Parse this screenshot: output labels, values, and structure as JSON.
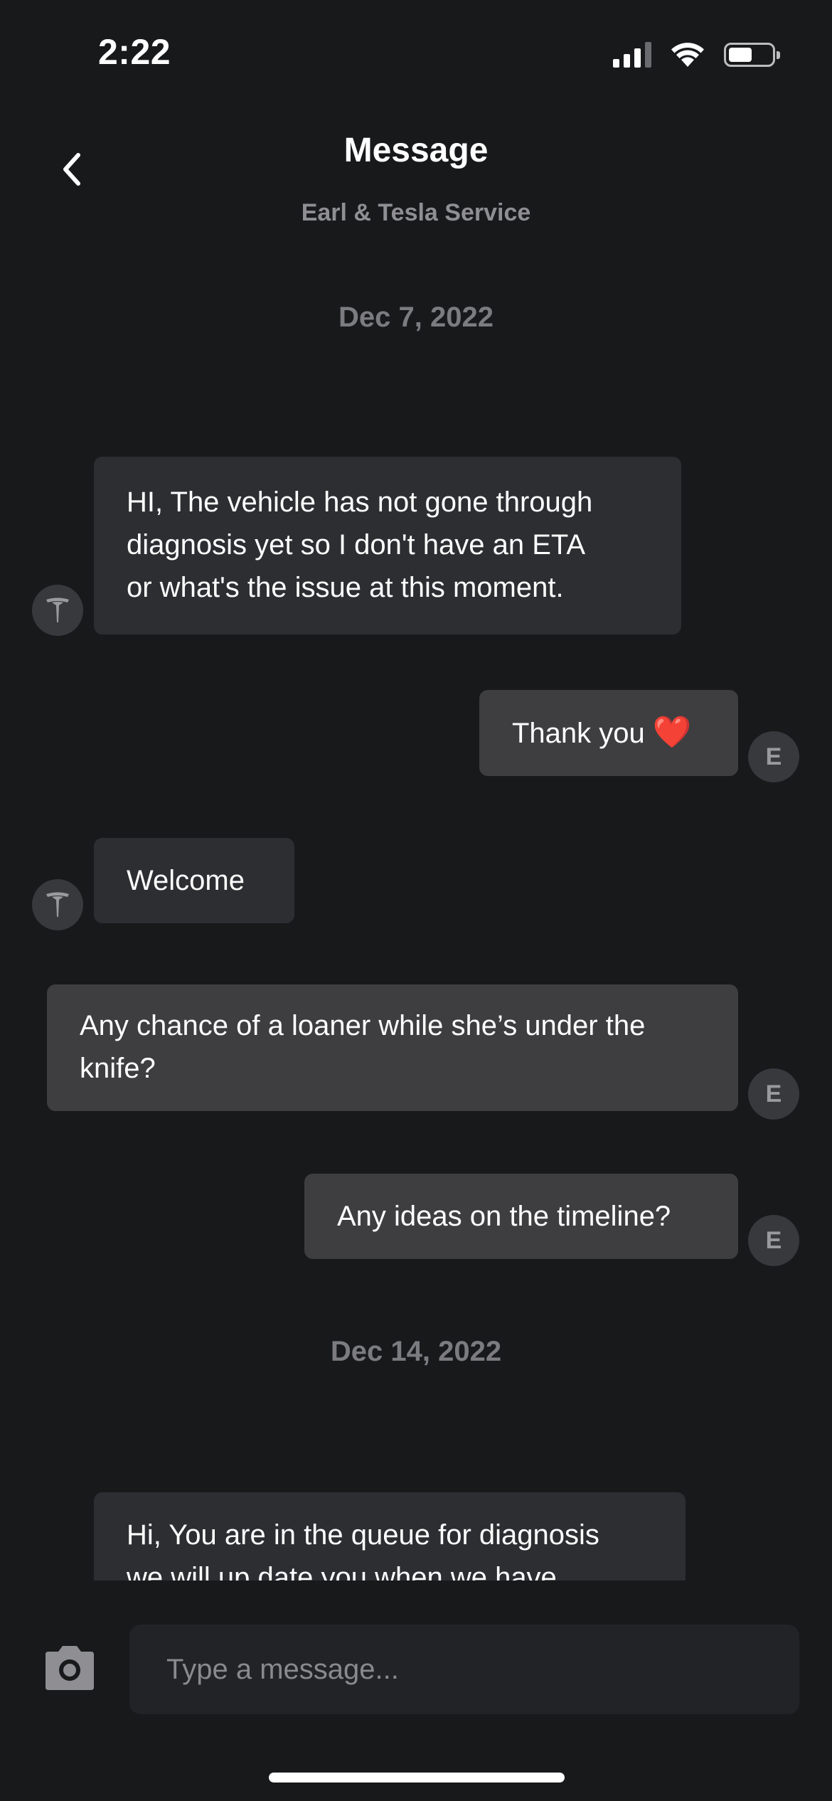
{
  "status_bar": {
    "time": "2:22",
    "battery_level": 0.55
  },
  "header": {
    "title": "Message",
    "subtitle": "Earl & Tesla Service"
  },
  "thread": {
    "date_1": "Dec 7, 2022",
    "msg_1_lines": [
      "HI, The vehicle has not gone through",
      "diagnosis yet so I don't have an ETA",
      "or what's the issue at this moment."
    ],
    "msg_2_text": "Thank you",
    "msg_2_emoji": "❤️",
    "msg_3_text": "Welcome",
    "msg_4_lines": [
      "Any chance of a loaner while she’s under the",
      "knife?"
    ],
    "msg_5_text": "Any ideas on the timeline?",
    "date_2": "Dec 14, 2022",
    "msg_6_lines": [
      "Hi, You are in the queue for diagnosis",
      "we will up date you when we have"
    ],
    "user_initial": "E"
  },
  "composer": {
    "placeholder": "Type a message..."
  },
  "colors": {
    "background": "#18191b",
    "incoming_bubble": "#2d2e32",
    "outgoing_bubble": "#3e3e40",
    "muted_text": "#8e8e93",
    "heart": "#e8232f"
  },
  "icons": {
    "back": "chevron-left-icon",
    "camera": "camera-icon",
    "service_avatar": "tesla-logo-icon",
    "signal": "cellular-signal-icon",
    "wifi": "wifi-icon",
    "battery": "battery-icon"
  }
}
